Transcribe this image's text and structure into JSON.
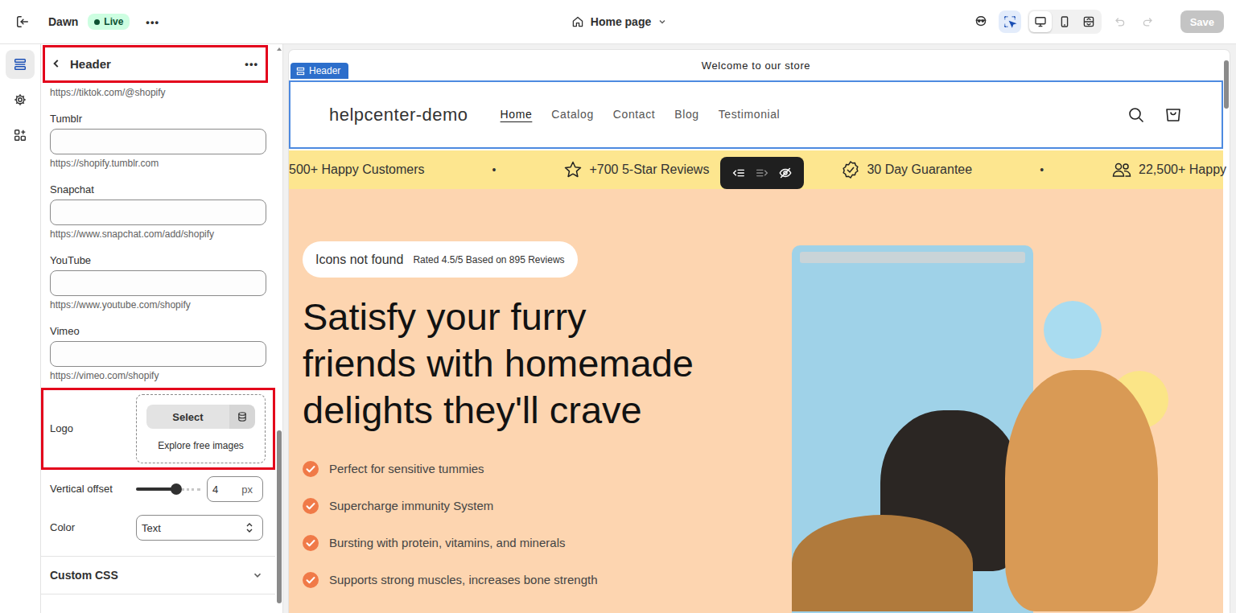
{
  "topbar": {
    "theme": "Dawn",
    "status": "Live",
    "more": "•••",
    "page": "Home page",
    "tools": [
      {
        "kind": "inspect",
        "selected": false
      },
      {
        "kind": "select",
        "selected": true
      }
    ],
    "devices": [
      {
        "kind": "desktop",
        "selected": true
      },
      {
        "kind": "mobile",
        "selected": false
      },
      {
        "kind": "fullscreen",
        "selected": false
      }
    ],
    "undo_disabled": true,
    "redo_disabled": true,
    "save": {
      "label": "Save",
      "disabled": true
    }
  },
  "rail": [
    {
      "kind": "sections",
      "selected": true
    },
    {
      "kind": "settings",
      "selected": false
    },
    {
      "kind": "apps",
      "selected": false
    }
  ],
  "panel": {
    "title": "Header",
    "more": "•••",
    "highlighted": true,
    "top_hint": "https://tiktok.com/@shopify",
    "fields": [
      {
        "label": "Tumblr",
        "value": "",
        "hint": "https://shopify.tumblr.com"
      },
      {
        "label": "Snapchat",
        "value": "",
        "hint": "https://www.snapchat.com/add/shopify"
      },
      {
        "label": "YouTube",
        "value": "",
        "hint": "https://www.youtube.com/shopify"
      },
      {
        "label": "Vimeo",
        "value": "",
        "hint": "https://vimeo.com/shopify"
      }
    ],
    "logo": {
      "label": "Logo",
      "button": "Select",
      "link": "Explore free images",
      "highlighted": true
    },
    "offset": {
      "label": "Vertical offset",
      "level": 0.62,
      "value": "4",
      "unit": "px"
    },
    "color": {
      "label": "Color",
      "value": "Text"
    },
    "custom_css": {
      "label": "Custom CSS",
      "expanded": false
    }
  },
  "preview": {
    "section_tag": "Header",
    "announcement": "Welcome to our store",
    "store_name": "helpcenter-demo",
    "nav": [
      {
        "label": "Home",
        "selected": true
      },
      {
        "label": "Catalog",
        "selected": false
      },
      {
        "label": "Contact",
        "selected": false
      },
      {
        "label": "Blog",
        "selected": false
      },
      {
        "label": "Testimonial",
        "selected": false
      }
    ],
    "marquee": [
      {
        "kind": "text",
        "text": "500+ Happy Customers"
      },
      {
        "kind": "dot",
        "text": "•"
      },
      {
        "kind": "star",
        "text": "+700 5-Star Reviews"
      },
      {
        "kind": "guarantee",
        "text": "30 Day Guarantee"
      },
      {
        "kind": "dot",
        "text": "•"
      },
      {
        "kind": "people",
        "text": "22,500+ Happy"
      }
    ],
    "hero": {
      "badge": "Icons not found",
      "rating": "Rated 4.5/5 Based on 895 Reviews",
      "heading_lines": [
        "Satisfy your furry",
        "friends with homemade",
        "delights they'll crave"
      ],
      "checklist": [
        "Perfect for sensitive tummies",
        "Supercharge immunity System",
        "Bursting with protein, vitamins, and minerals",
        "Supports strong muscles, increases bone strength"
      ]
    }
  }
}
